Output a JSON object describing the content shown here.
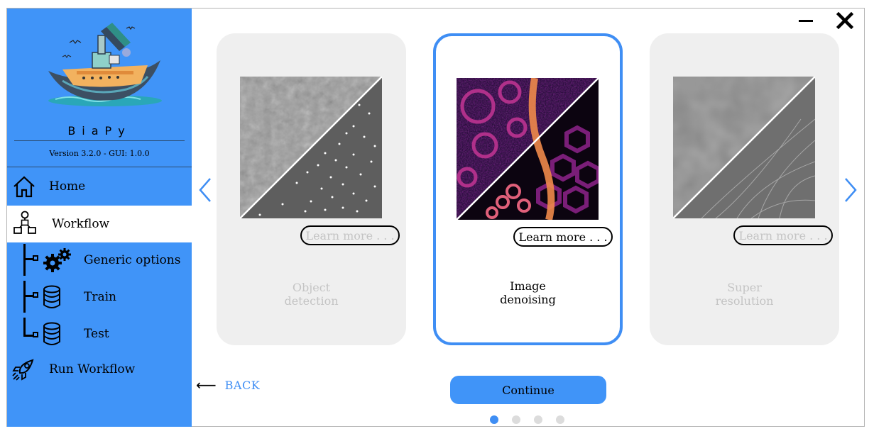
{
  "app": {
    "name": "BiaPy",
    "version": "Version 3.2.0 - GUI: 1.0.0"
  },
  "sidebar": {
    "items": [
      {
        "label": "Home",
        "icon": "home-icon"
      },
      {
        "label": "Workflow",
        "icon": "workflow-icon",
        "active": true
      },
      {
        "label": "Generic options",
        "icon": "gears-icon"
      },
      {
        "label": "Train",
        "icon": "database-icon"
      },
      {
        "label": "Test",
        "icon": "database-icon"
      },
      {
        "label": "Run Workflow",
        "icon": "rocket-icon"
      }
    ]
  },
  "cards": [
    {
      "title": "Object\ndetection",
      "learn": "Learn more . . .",
      "selected": false
    },
    {
      "title": "Image\ndenoising",
      "learn": "Learn more . . .",
      "selected": true
    },
    {
      "title": "Super\nresolution",
      "learn": "Learn more . . .",
      "selected": false
    }
  ],
  "nav": {
    "back": "BACK",
    "continue": "Continue"
  },
  "pager": {
    "count": 4,
    "current": 1
  },
  "colors": {
    "sidebar": "#4094f8",
    "accent": "#3f8ef4",
    "card_inactive": "#efefef",
    "dim_text": "#c4c4c4"
  }
}
